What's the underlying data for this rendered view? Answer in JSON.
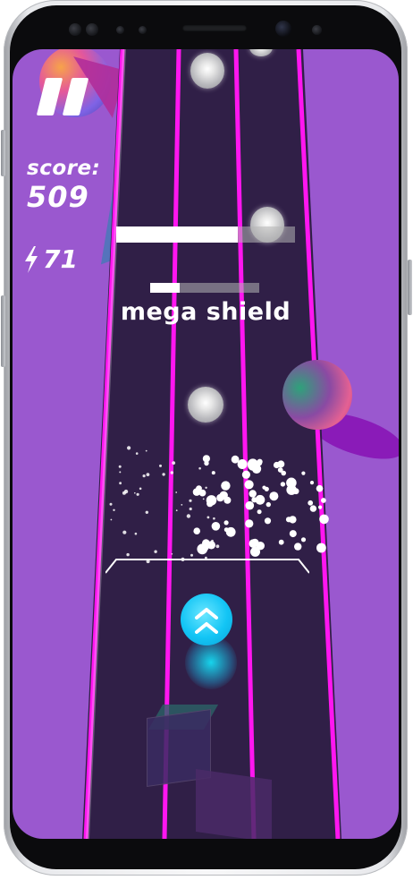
{
  "hud": {
    "score_label": "score:",
    "score_value": "509",
    "energy_value": "71",
    "powerup_label": "mega shield",
    "energy_icon": "lightning-bolt-icon",
    "pause_icon": "pause-icon"
  },
  "powerup": {
    "timer_bar_fraction": 0.68,
    "secondary_bar_fraction": 0.27
  },
  "colors": {
    "background": "#9a58cf",
    "road": "#301f47",
    "lane_lines": "#ff16f0",
    "player": "#13c5f5",
    "text": "#ffffff"
  },
  "player": {
    "icon": "double-chevron-up-icon"
  }
}
